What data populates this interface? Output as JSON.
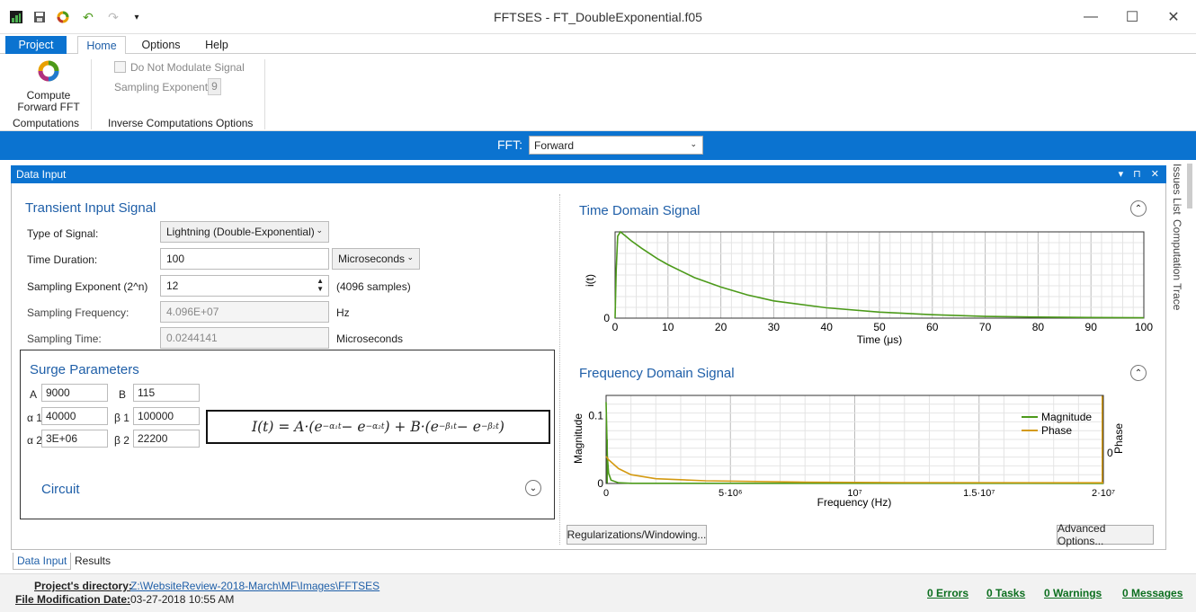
{
  "window": {
    "title": "FFTSES - FT_DoubleExponential.f05",
    "minimize": "—",
    "maximize": "☐",
    "close": "✕"
  },
  "menu": {
    "project": "Project",
    "home": "Home",
    "options": "Options",
    "help": "Help"
  },
  "ribbon": {
    "compute_label_1": "Compute",
    "compute_label_2": "Forward FFT",
    "group_computations": "Computations",
    "no_modulate": "Do Not Modulate Signal",
    "sampling_exp_label": "Sampling Exponent",
    "sampling_exp_value": "9",
    "group_inverse": "Inverse Computations Options"
  },
  "fft": {
    "label": "FFT:",
    "value": "Forward"
  },
  "data_input": {
    "title": "Data Input"
  },
  "transient": {
    "title": "Transient Input Signal",
    "type_label": "Type of Signal:",
    "type_value": "Lightning (Double-Exponential)",
    "duration_label": "Time Duration:",
    "duration_value": "100",
    "duration_unit": "Microseconds",
    "sexp_label": "Sampling Exponent (2^n)",
    "sexp_value": "12",
    "sexp_note": "(4096 samples)",
    "sfreq_label": "Sampling Frequency:",
    "sfreq_value": "4.096E+07",
    "sfreq_unit": "Hz",
    "stime_label": "Sampling Time:",
    "stime_value": "0.0244141",
    "stime_unit": "Microseconds"
  },
  "surge": {
    "title": "Surge Parameters",
    "A_label": "A",
    "A": "9000",
    "B_label": "B",
    "B": "115",
    "a1_label": "α 1",
    "a1": "40000",
    "b1_label": "β 1",
    "b1": "100000",
    "a2_label": "α 2",
    "a2": "3E+06",
    "b2_label": "β 2",
    "b2": "22200",
    "circuit": "Circuit"
  },
  "time_chart": {
    "title": "Time Domain Signal",
    "xlabel": "Time (μs)",
    "ylabel": "i(t)"
  },
  "freq_chart": {
    "title": "Frequency Domain Signal",
    "xlabel": "Frequency (Hz)",
    "ylabel": "Magnitude",
    "y2label": "Phase"
  },
  "buttons": {
    "regularizations": "Regularizations/Windowing...",
    "advanced": "Advanced Options..."
  },
  "side_tabs": {
    "issues": "Issues List",
    "trace": "Computation Trace"
  },
  "bottom_tabs": {
    "data_input": "Data Input",
    "results": "Results"
  },
  "status": {
    "proj_dir_label": "Project's directory:",
    "proj_dir": "Z:\\WebsiteReview-2018-March\\MF\\Images\\FFTSES",
    "mod_label": "File Modification Date:",
    "mod_value": "03-27-2018 10:55 AM",
    "errors": "0 Errors",
    "tasks": "0 Tasks",
    "warnings": "0 Warnings",
    "messages": "0 Messages"
  },
  "chart_data": [
    {
      "type": "line",
      "title": "Time Domain Signal",
      "xlabel": "Time (μs)",
      "ylabel": "i(t)",
      "xlim": [
        0,
        100
      ],
      "xticks": [
        "0",
        "10",
        "20",
        "30",
        "40",
        "50",
        "60",
        "70",
        "80",
        "90",
        "100"
      ],
      "yticks": [
        "0"
      ],
      "grid": true,
      "series": [
        {
          "color": "#4c9a1a",
          "x": [
            0,
            0.2,
            0.5,
            1,
            2,
            3,
            5,
            8,
            10,
            15,
            20,
            25,
            30,
            40,
            50,
            60,
            70,
            80,
            90,
            100
          ],
          "y": [
            0,
            0.55,
            0.95,
            1.0,
            0.95,
            0.9,
            0.81,
            0.69,
            0.62,
            0.47,
            0.36,
            0.27,
            0.2,
            0.12,
            0.07,
            0.04,
            0.02,
            0.012,
            0.007,
            0.004
          ]
        }
      ]
    },
    {
      "type": "line",
      "title": "Frequency Domain Signal",
      "xlabel": "Frequency (Hz)",
      "ylabel": "Magnitude",
      "y2label": "Phase",
      "xlim": [
        0,
        20000000
      ],
      "xticks": [
        "0",
        "5·10⁶",
        "10⁷",
        "1.5·10⁷",
        "2·10⁷"
      ],
      "yticks": [
        "0",
        "0.1"
      ],
      "y2ticks": [
        "0"
      ],
      "legend": "top-right",
      "grid": true,
      "series": [
        {
          "name": "Magnitude",
          "color": "#4c9a1a",
          "x": [
            0,
            50000,
            100000,
            200000,
            500000,
            1000000,
            20000000
          ],
          "y": [
            0.12,
            0.04,
            0.015,
            0.005,
            0.001,
            0.0003,
            0.0001
          ]
        },
        {
          "name": "Phase",
          "color": "#d49a12",
          "x": [
            0,
            100000,
            500000,
            1000000,
            2000000,
            4000000,
            8000000,
            12000000,
            20000000
          ],
          "y": [
            0.04,
            0.035,
            0.022,
            0.013,
            0.007,
            0.004,
            0.002,
            0.0013,
            0.001
          ]
        }
      ]
    }
  ]
}
